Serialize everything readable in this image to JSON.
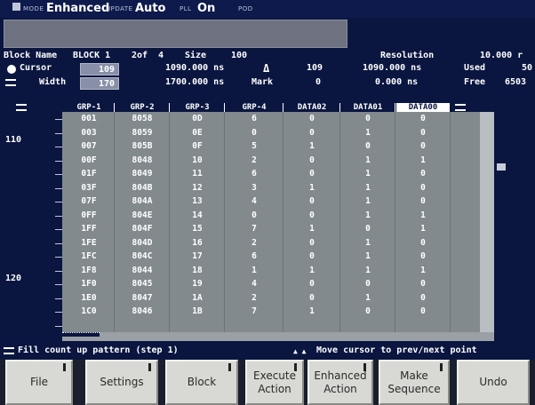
{
  "topbar": {
    "mode_label": "MODE",
    "mode_value": "Enhanced",
    "update_label": "UPDATE",
    "update_value": "Auto",
    "pll_label": "PLL",
    "pll_value": "On",
    "pod_label": "POD"
  },
  "header": {
    "block_name_label": "Block Name",
    "block_name_value": "BLOCK 1",
    "block_of": "2of",
    "block_count": "4",
    "size_label": "Size",
    "size_value": "100",
    "resolution_label": "Resolution",
    "resolution_value": "10.000 r",
    "cursor_label": "Cursor",
    "cursor_value": "109",
    "cursor_time": "1090.000 ns",
    "delta_symbol": "Δ",
    "delta_value": "109",
    "delta_time": "1090.000 ns",
    "used_label": "Used",
    "used_value": "50",
    "width_label": "Width",
    "width_value": "170",
    "width_time": "1700.000 ns",
    "mark_label": "Mark",
    "mark_value": "0",
    "mark_time": "0.000 ns",
    "free_label": "Free",
    "free_value": "6503"
  },
  "columns": [
    "GRP-1",
    "GRP-2",
    "GRP-3",
    "GRP-4",
    "DATA02",
    "DATA01",
    "DATA00"
  ],
  "y_labels": {
    "top": "110",
    "bottom": "120"
  },
  "rows": [
    [
      "001",
      "8058",
      "0D",
      "6",
      "0",
      "0",
      "0"
    ],
    [
      "003",
      "8059",
      "0E",
      "0",
      "0",
      "1",
      "0"
    ],
    [
      "007",
      "805B",
      "0F",
      "5",
      "1",
      "0",
      "0"
    ],
    [
      "00F",
      "8048",
      "10",
      "2",
      "0",
      "1",
      "1"
    ],
    [
      "01F",
      "8049",
      "11",
      "6",
      "0",
      "1",
      "0"
    ],
    [
      "03F",
      "804B",
      "12",
      "3",
      "1",
      "1",
      "0"
    ],
    [
      "07F",
      "804A",
      "13",
      "4",
      "0",
      "1",
      "0"
    ],
    [
      "0FF",
      "804E",
      "14",
      "0",
      "0",
      "1",
      "1"
    ],
    [
      "1FF",
      "804F",
      "15",
      "7",
      "1",
      "0",
      "1"
    ],
    [
      "1FE",
      "804D",
      "16",
      "2",
      "0",
      "1",
      "0"
    ],
    [
      "1FC",
      "804C",
      "17",
      "6",
      "0",
      "1",
      "0"
    ],
    [
      "1F8",
      "8044",
      "18",
      "1",
      "1",
      "1",
      "1"
    ],
    [
      "1F0",
      "8045",
      "19",
      "4",
      "0",
      "0",
      "0"
    ],
    [
      "1E0",
      "8047",
      "1A",
      "2",
      "0",
      "1",
      "0"
    ],
    [
      "1C0",
      "8046",
      "1B",
      "7",
      "1",
      "0",
      "0"
    ]
  ],
  "status": {
    "left": "Fill count up pattern (step 1)",
    "right": "Move cursor to prev/next point"
  },
  "softkeys": [
    "File",
    "Settings",
    "Block",
    "Execute\nAction",
    "Enhanced\nAction",
    "Make\nSequence",
    "Undo"
  ]
}
